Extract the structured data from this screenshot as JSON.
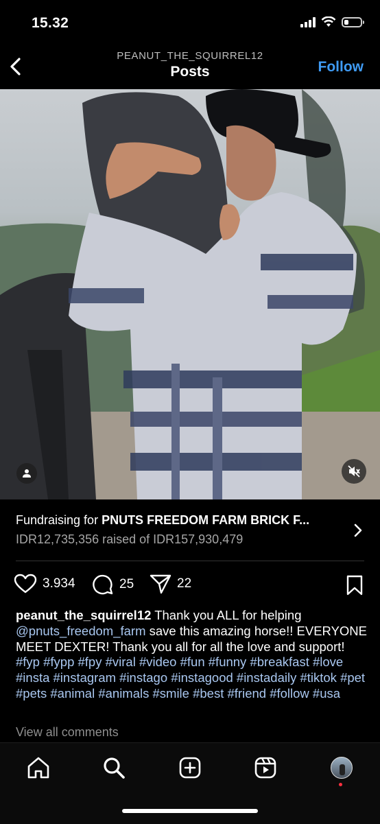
{
  "status_bar": {
    "time": "15.32"
  },
  "header": {
    "username": "PEANUT_THE_SQUIRREL12",
    "title": "Posts",
    "follow_label": "Follow"
  },
  "fundraiser": {
    "prefix": "Fundraising for ",
    "name": "PNUTS FREEDOM FARM BRICK F...",
    "progress": "IDR12,735,356 raised of IDR157,930,479"
  },
  "actions": {
    "likes": "3.934",
    "comments": "25",
    "shares": "22"
  },
  "caption": {
    "author": "peanut_the_squirrel12",
    "text_1": " Thank you ALL for helping ",
    "mention": "@pnuts_freedom_farm",
    "text_2": " save this amazing horse!! EVERYONE MEET DEXTER! Thank you all for all the love and support! ",
    "hashtags": "#fyp #fypp #fpy #viral #video #fun #funny #breakfast #love #insta #instagram #instago #instagood #instadaily #tiktok #pet #pets #animal #animals #smile #best #friend #follow #usa"
  },
  "view_comments": "View all comments",
  "colors": {
    "accent": "#3f9bf4",
    "link": "#a9c7f0",
    "muted": "#a6a6a6",
    "notification": "#ff3040"
  },
  "icons": [
    "chevron-left-icon",
    "user-tag-icon",
    "mute-icon",
    "chevron-right-icon",
    "heart-icon",
    "comment-icon",
    "share-icon",
    "bookmark-icon",
    "home-icon",
    "search-icon",
    "create-icon",
    "reels-icon",
    "profile-avatar"
  ]
}
